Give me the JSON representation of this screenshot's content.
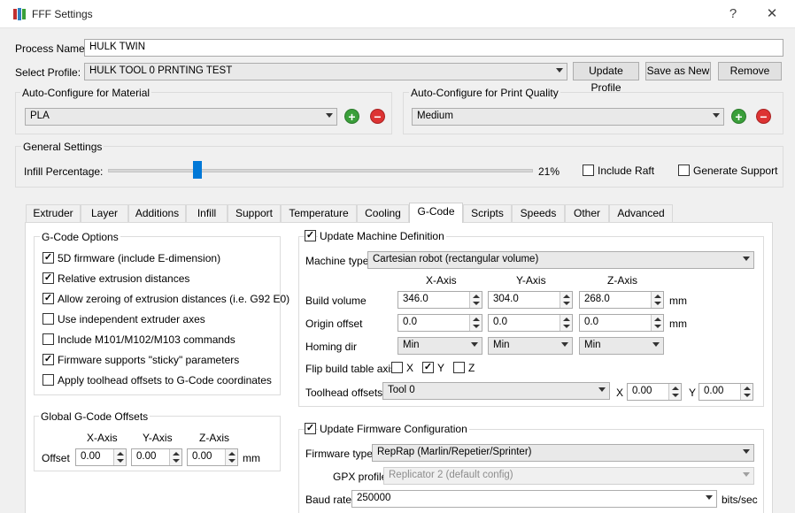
{
  "window": {
    "title": "FFF Settings",
    "help": "?",
    "close": "✕"
  },
  "process_name": {
    "label": "Process Name:",
    "value": "HULK TWIN"
  },
  "select_profile": {
    "label": "Select Profile:",
    "value": "HULK TOOL 0 PRNTING TEST",
    "update": "Update Profile",
    "save_as_new": "Save as New",
    "remove": "Remove"
  },
  "material": {
    "title": "Auto-Configure for Material",
    "value": "PLA"
  },
  "quality": {
    "title": "Auto-Configure for Print Quality",
    "value": "Medium"
  },
  "general": {
    "title": "General Settings",
    "infill_label": "Infill Percentage:",
    "infill_value": "21%",
    "infill_fraction": 0.21,
    "include_raft": "Include Raft",
    "generate_support": "Generate Support"
  },
  "tabs": [
    "Extruder",
    "Layer",
    "Additions",
    "Infill",
    "Support",
    "Temperature",
    "Cooling",
    "G-Code",
    "Scripts",
    "Speeds",
    "Other",
    "Advanced"
  ],
  "active_tab": "G-Code",
  "gcode_options": {
    "title": "G-Code Options",
    "items": [
      {
        "label": "5D firmware (include E-dimension)",
        "checked": true
      },
      {
        "label": "Relative extrusion distances",
        "checked": true
      },
      {
        "label": "Allow zeroing of extrusion distances (i.e. G92 E0)",
        "checked": true
      },
      {
        "label": "Use independent extruder axes",
        "checked": false
      },
      {
        "label": "Include M101/M102/M103 commands",
        "checked": false
      },
      {
        "label": "Firmware supports \"sticky\" parameters",
        "checked": true
      },
      {
        "label": "Apply toolhead offsets to G-Code coordinates",
        "checked": false
      }
    ]
  },
  "global_offsets": {
    "title": "Global G-Code Offsets",
    "x_axis": "X-Axis",
    "y_axis": "Y-Axis",
    "z_axis": "Z-Axis",
    "offset_label": "Offset",
    "x": "0.00",
    "y": "0.00",
    "z": "0.00",
    "unit": "mm"
  },
  "machine": {
    "update_label": "Update Machine Definition",
    "type_label": "Machine type",
    "type_value": "Cartesian robot (rectangular volume)",
    "x_axis": "X-Axis",
    "y_axis": "Y-Axis",
    "z_axis": "Z-Axis",
    "build_label": "Build volume",
    "build_x": "346.0",
    "build_y": "304.0",
    "build_z": "268.0",
    "origin_label": "Origin offset",
    "origin_x": "0.0",
    "origin_y": "0.0",
    "origin_z": "0.0",
    "unit": "mm",
    "homing_label": "Homing dir",
    "homing_x": "Min",
    "homing_y": "Min",
    "homing_z": "Min",
    "flip_label": "Flip build table axis",
    "flip_x": "X",
    "flip_y": "Y",
    "flip_z": "Z",
    "toolhead_label": "Toolhead offsets",
    "toolhead_value": "Tool 0",
    "th_x_label": "X",
    "th_x": "0.00",
    "th_y_label": "Y",
    "th_y": "0.00"
  },
  "firmware": {
    "update_label": "Update Firmware Configuration",
    "type_label": "Firmware type",
    "type_value": "RepRap (Marlin/Repetier/Sprinter)",
    "gpx_label": "GPX profile",
    "gpx_value": "Replicator 2 (default config)",
    "baud_label": "Baud rate",
    "baud_value": "250000",
    "baud_unit": "bits/sec"
  }
}
